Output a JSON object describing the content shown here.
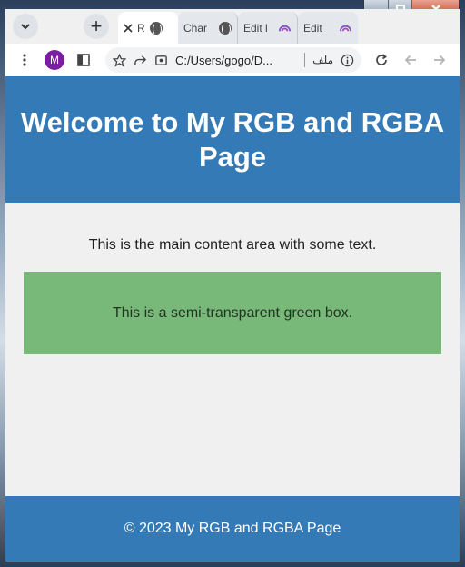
{
  "browser": {
    "tabs": [
      {
        "label": "R",
        "active": true
      },
      {
        "label": "Char"
      },
      {
        "label": "Edit l"
      },
      {
        "label": "Edit "
      }
    ],
    "new_tab_symbol": "+",
    "profile_initial": "M",
    "address": "C:/Users/gogo/D...",
    "chip_text": "ملف",
    "icons": {
      "tab_search": "chevron-down-icon",
      "new_tab": "plus-icon",
      "tab_close": "close-icon",
      "menu": "kebab-menu-icon",
      "sidepanel": "side-panel-icon",
      "bookmark": "star-icon",
      "share": "share-icon",
      "site": "file-icon",
      "info": "info-icon",
      "reload": "reload-icon",
      "back": "back-arrow-icon",
      "forward": "forward-arrow-icon"
    }
  },
  "page": {
    "header_title": "Welcome to My RGB and RGBA Page",
    "main_text": "This is the main content area with some text.",
    "box_text": "This is a semi-transparent green box.",
    "footer_text": "© 2023 My RGB and RGBA Page"
  },
  "colors": {
    "header_bg": "#337ab7",
    "footer_bg": "#337ab7",
    "page_bg": "#f0f0f0",
    "box_bg": "rgba(0, 128, 0, 0.5)",
    "profile_bg": "#7b1fa2"
  }
}
